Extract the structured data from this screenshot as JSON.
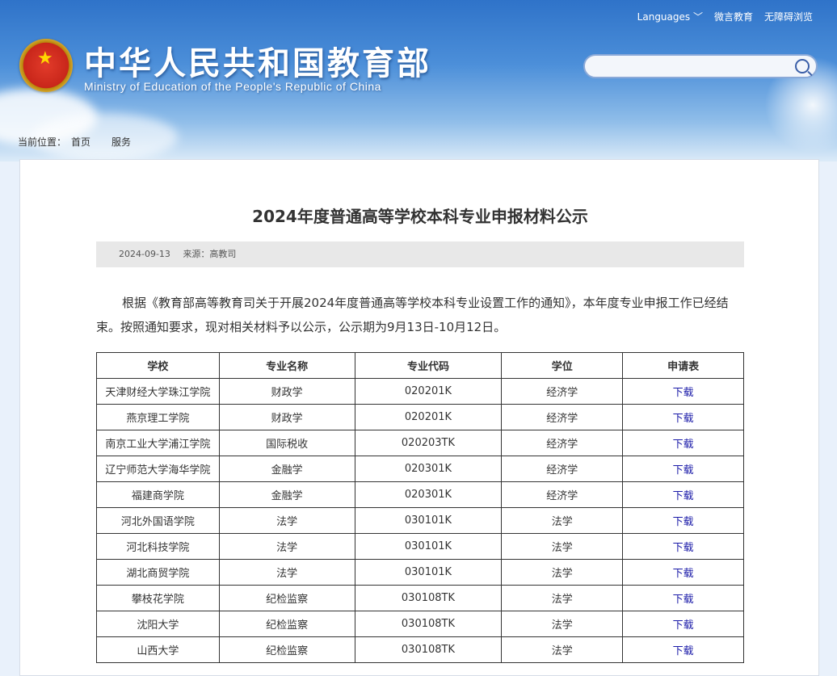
{
  "header": {
    "top_links": [
      "Languages ﹀",
      "微言教育",
      "无障碍浏览"
    ],
    "title": "中华人民共和国教育部",
    "subtitle": "Ministry of Education of the People's Republic of China",
    "search": {
      "placeholder": ""
    }
  },
  "breadcrumb": {
    "label": "当前位置：",
    "home": "首页",
    "current": "服务"
  },
  "article": {
    "title": "2024年度普通高等学校本科专业申报材料公示",
    "date": "2024-09-13",
    "source": "来源：高教司",
    "paragraph": "根据《教育部高等教育司关于开展2024年度普通高等学校本科专业设置工作的通知》，本年度专业申报工作已经结束。按照通知要求，现对相关材料予以公示，公示期为9月13日-10月12日。"
  },
  "table": {
    "headers": [
      "学校",
      "专业名称",
      "专业代码",
      "学位",
      "申请表"
    ],
    "rows": [
      [
        "天津财经大学珠江学院",
        "财政学",
        "020201K",
        "经济学",
        "下载"
      ],
      [
        "燕京理工学院",
        "财政学",
        "020201K",
        "经济学",
        "下载"
      ],
      [
        "南京工业大学浦江学院",
        "国际税收",
        "020203TK",
        "经济学",
        "下载"
      ],
      [
        "辽宁师范大学海华学院",
        "金融学",
        "020301K",
        "经济学",
        "下载"
      ],
      [
        "福建商学院",
        "金融学",
        "020301K",
        "经济学",
        "下载"
      ],
      [
        "河北外国语学院",
        "法学",
        "030101K",
        "法学",
        "下载"
      ],
      [
        "河北科技学院",
        "法学",
        "030101K",
        "法学",
        "下载"
      ],
      [
        "湖北商贸学院",
        "法学",
        "030101K",
        "法学",
        "下载"
      ],
      [
        "攀枝花学院",
        "纪检监察",
        "030108TK",
        "法学",
        "下载"
      ],
      [
        "沈阳大学",
        "纪检监察",
        "030108TK",
        "法学",
        "下载"
      ],
      [
        "山西大学",
        "纪检监察",
        "030108TK",
        "法学",
        "下载"
      ]
    ]
  }
}
